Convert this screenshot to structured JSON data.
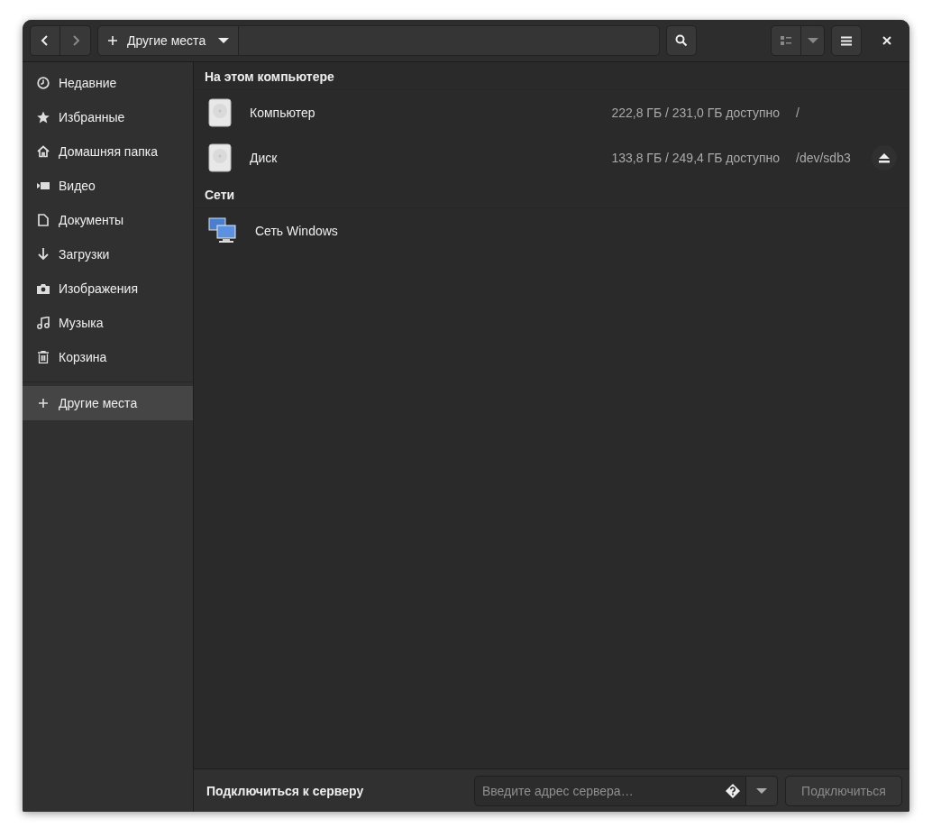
{
  "header": {
    "back": {
      "disabled": false
    },
    "forward": {
      "disabled": true
    },
    "location": {
      "label": "Другие места"
    }
  },
  "sidebar": {
    "items": [
      {
        "kind": "recent",
        "label": "Недавние",
        "selected": false
      },
      {
        "kind": "starred",
        "label": "Избранные",
        "selected": false
      },
      {
        "kind": "home",
        "label": "Домашняя папка",
        "selected": false
      },
      {
        "kind": "videos",
        "label": "Видео",
        "selected": false
      },
      {
        "kind": "documents",
        "label": "Документы",
        "selected": false
      },
      {
        "kind": "downloads",
        "label": "Загрузки",
        "selected": false
      },
      {
        "kind": "pictures",
        "label": "Изображения",
        "selected": false
      },
      {
        "kind": "music",
        "label": "Музыка",
        "selected": false
      },
      {
        "kind": "trash",
        "label": "Корзина",
        "selected": false
      },
      {
        "kind": "other",
        "label": "Другие места",
        "selected": true
      }
    ]
  },
  "sections": [
    {
      "title": "На этом компьютере",
      "items": [
        {
          "kind": "drive",
          "name": "Компьютер",
          "usage": "222,8 ГБ / 231,0 ГБ доступно",
          "path": "/",
          "ejectable": false
        },
        {
          "kind": "drive",
          "name": "Диск",
          "usage": "133,8 ГБ / 249,4 ГБ доступно",
          "path": "/dev/sdb3",
          "ejectable": true
        }
      ]
    },
    {
      "title": "Сети",
      "items": [
        {
          "kind": "network",
          "name": "Сеть Windows"
        }
      ]
    }
  ],
  "connect_bar": {
    "label": "Подключиться к серверу",
    "placeholder": "Введите адрес сервера…",
    "button": {
      "label": "Подключиться",
      "disabled": true
    }
  }
}
